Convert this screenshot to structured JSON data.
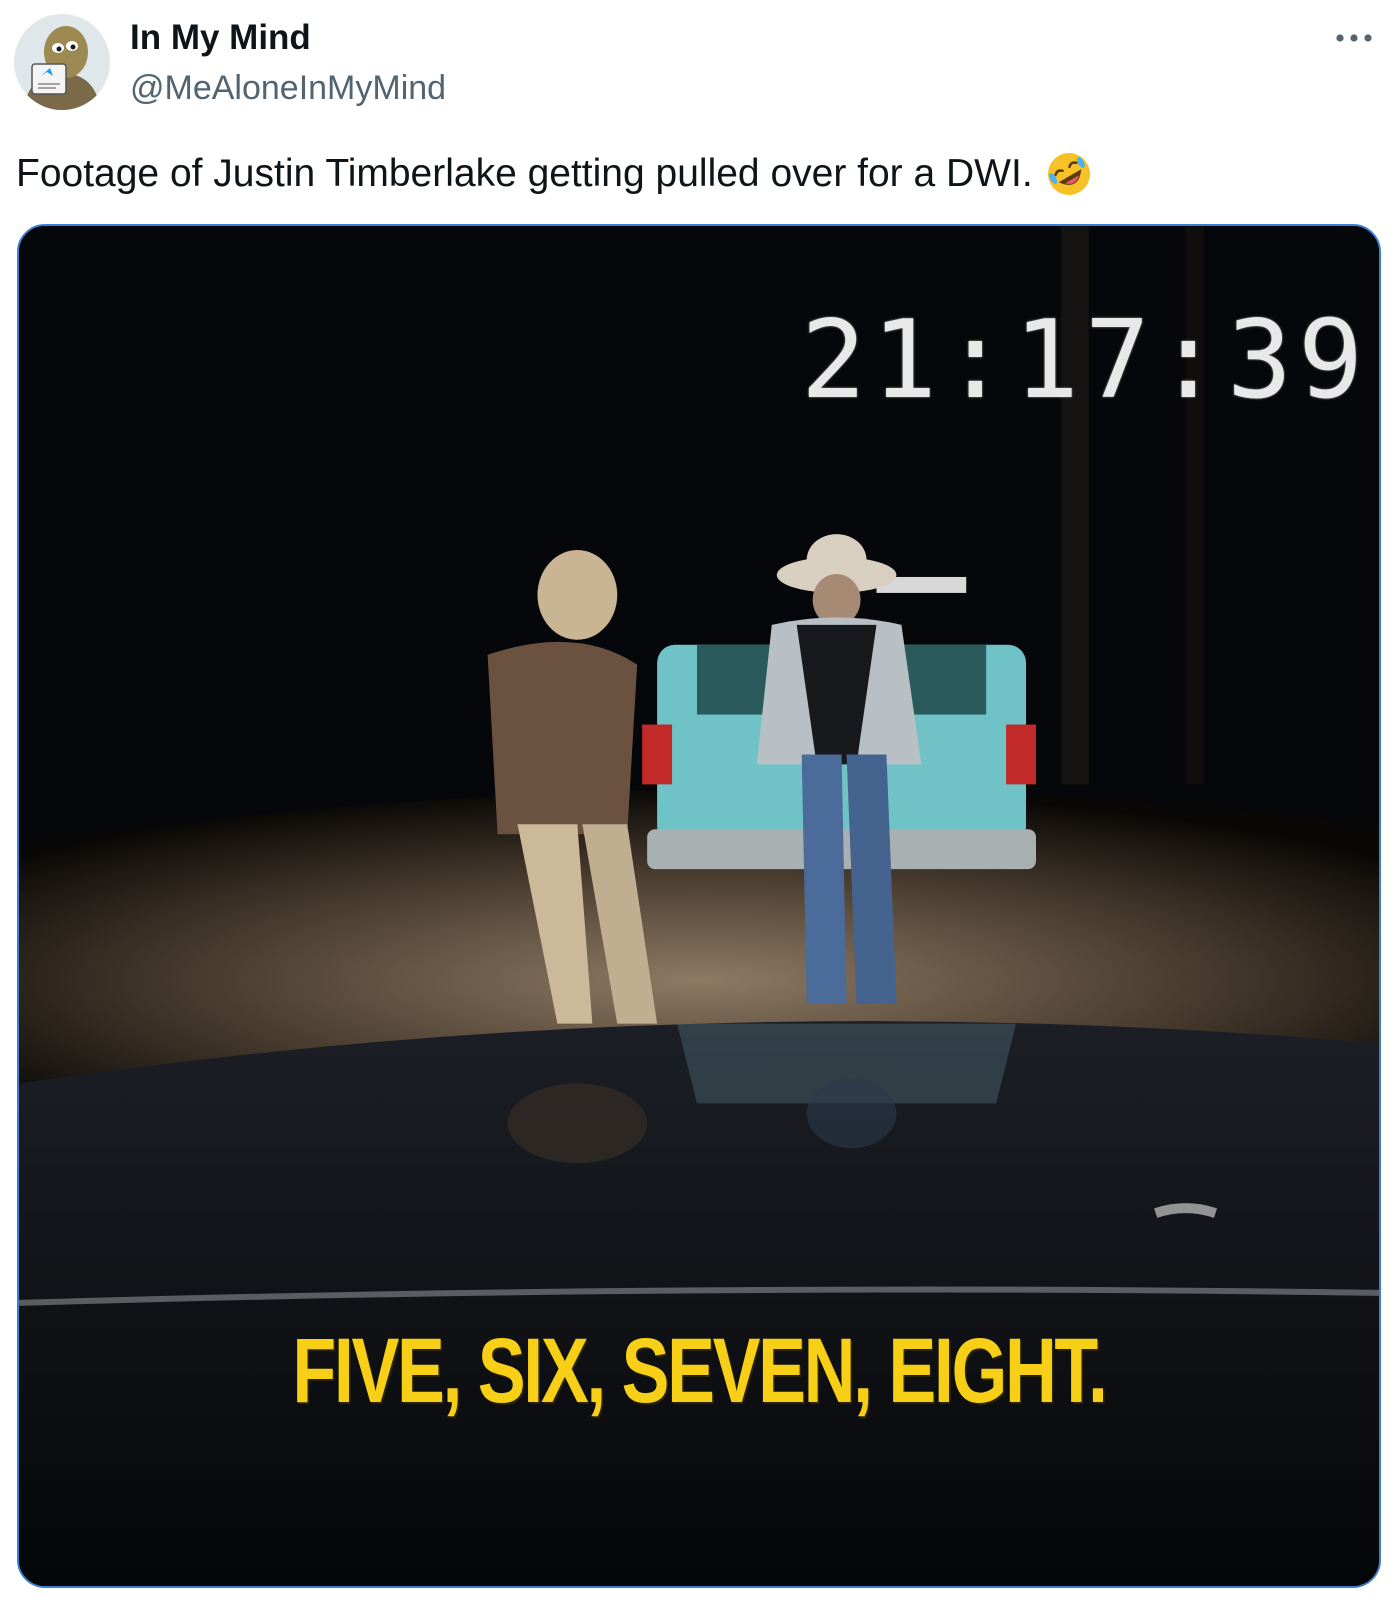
{
  "author": {
    "display_name": "In My Mind",
    "handle": "@MeAloneInMyMind",
    "avatar_icon": "cartoon-avatar-icon"
  },
  "menu": {
    "more_icon": "more-options-icon"
  },
  "tweet": {
    "text": "Footage of Justin Timberlake getting pulled over for a DWI.",
    "emoji_icon": "rolling-on-floor-laughing-emoji"
  },
  "media": {
    "type": "video",
    "timestamp_overlay": "21:17:39",
    "caption_overlay": "FIVE, SIX, SEVEN, EIGHT.",
    "border_color": "#3b7fd4",
    "caption_color": "#f6cf16"
  }
}
